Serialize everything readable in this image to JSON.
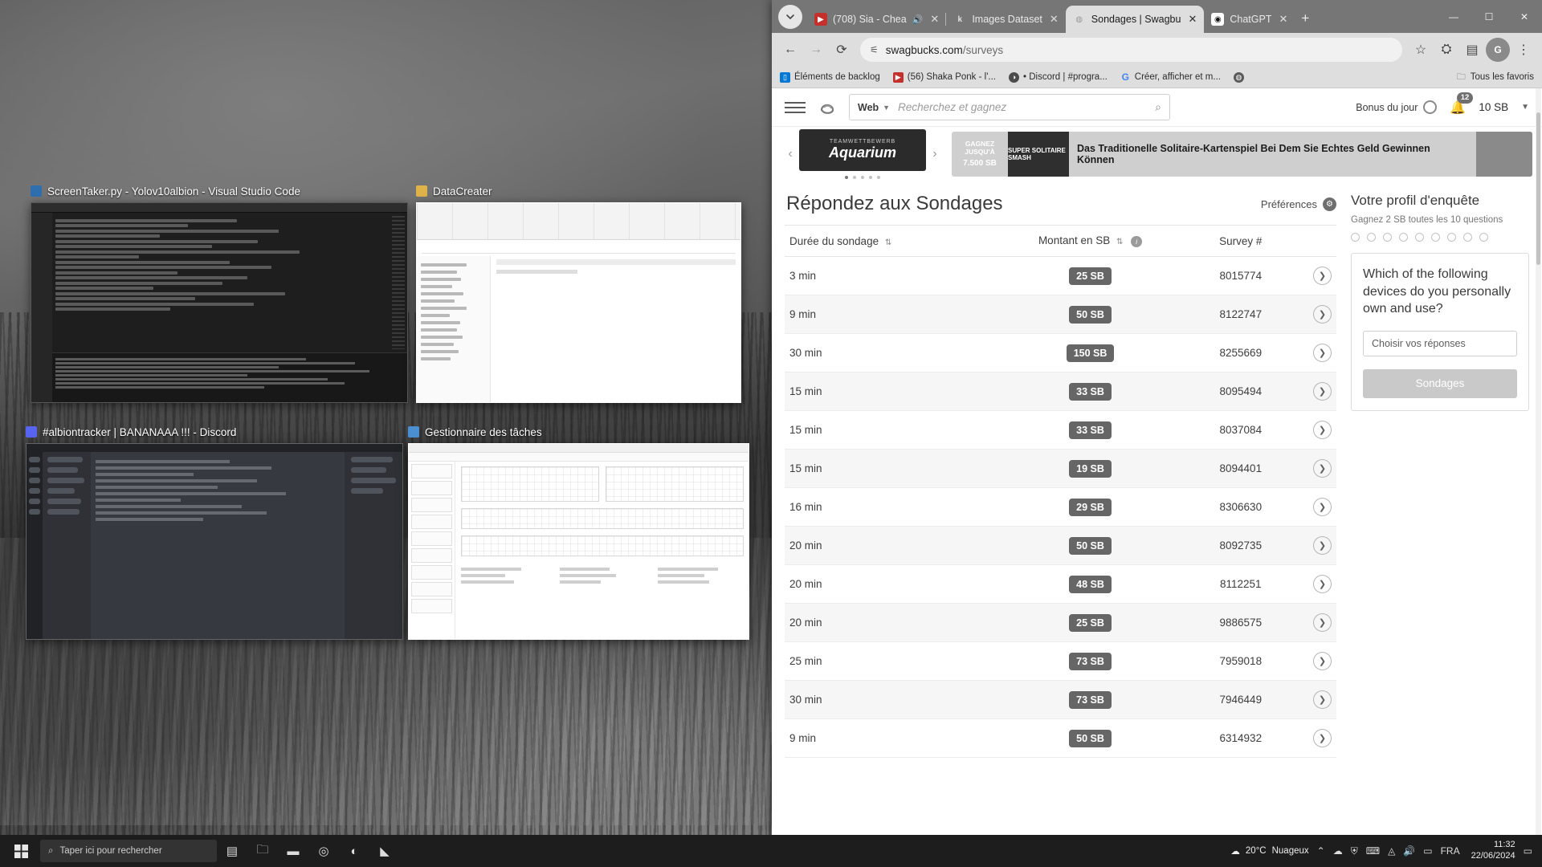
{
  "browser": {
    "tabs": [
      {
        "title": "(708) Sia - Chea",
        "favicon": "youtube-icon",
        "active": false,
        "muted_icon": "audio-icon"
      },
      {
        "title": "Images Dataset",
        "favicon": "kaggle-icon",
        "active": false
      },
      {
        "title": "Sondages | Swagbu",
        "favicon": "swagbucks-icon",
        "active": true
      },
      {
        "title": "ChatGPT",
        "favicon": "openai-icon",
        "active": false
      }
    ],
    "new_tab_label": "+",
    "url_host": "swagbucks.com",
    "url_path": "/surveys",
    "back_icon": "back-arrow-icon",
    "forward_icon": "forward-arrow-icon",
    "reload_icon": "reload-icon",
    "site_info_icon": "tune-icon",
    "bookmark_star_icon": "star-icon",
    "extensions_icon": "puzzle-icon",
    "split_icon": "reading-list-icon",
    "profile_initial": "G",
    "menu_icon": "kebab-menu-icon",
    "window_minimize": "—",
    "window_maximize": "☐",
    "window_close": "✕",
    "bookmarks": [
      {
        "label": "Éléments de backlog",
        "icon": "azure-devops-icon"
      },
      {
        "label": "(56) Shaka Ponk - l'...",
        "icon": "youtube-icon"
      },
      {
        "label": "• Discord | #progra...",
        "icon": "discord-icon"
      },
      {
        "label": "Créer, afficher et m...",
        "icon": "google-icon"
      },
      {
        "label": "",
        "icon": "globe-icon"
      }
    ],
    "all_bookmarks_label": "Tous les favoris",
    "all_bookmarks_icon": "folder-icon"
  },
  "swagbucks": {
    "menu_icon": "hamburger-menu-icon",
    "logo_icon": "swagbucks-logo-icon",
    "search": {
      "scope_label": "Web",
      "caret_icon": "chevron-down-icon",
      "placeholder": "Recherchez et gagnez",
      "search_icon": "search-icon"
    },
    "bonus_label": "Bonus du jour",
    "bonus_icon": "bonus-ring-icon",
    "notifications_icon": "bell-icon",
    "notifications_count": "12",
    "balance": "10 SB",
    "account_caret_icon": "chevron-down-icon",
    "promo_left": {
      "top_label": "TEAMWETTBEWERB",
      "main_label": "Aquarium",
      "prev_icon": "chevron-left-icon",
      "next_icon": "chevron-right-icon"
    },
    "promo_right": {
      "gagnez_label": "GAGNEZ JUSQU'À",
      "amount": "7.500 SB",
      "brand": "SUPER SOLITAIRE SMASH",
      "text": "Das Traditionelle Solitaire-Kartenspiel Bei Dem Sie Echtes Geld Gewinnen Können"
    },
    "surveys": {
      "heading": "Répondez aux Sondages",
      "prefs_label": "Préférences",
      "prefs_icon": "gear-icon",
      "columns": [
        {
          "label": "Durée du sondage",
          "sort_icon": "sort-icon"
        },
        {
          "label": "Montant en SB",
          "sort_icon": "sort-icon",
          "info_icon": "info-icon"
        },
        {
          "label": "Survey #"
        }
      ],
      "rows": [
        {
          "duration": "3 min",
          "amount": "25 SB",
          "survey_id": "8015774",
          "go_icon": "chevron-right-icon"
        },
        {
          "duration": "9 min",
          "amount": "50 SB",
          "survey_id": "8122747",
          "go_icon": "chevron-right-icon"
        },
        {
          "duration": "30 min",
          "amount": "150 SB",
          "survey_id": "8255669",
          "go_icon": "chevron-right-icon"
        },
        {
          "duration": "15 min",
          "amount": "33 SB",
          "survey_id": "8095494",
          "go_icon": "chevron-right-icon"
        },
        {
          "duration": "15 min",
          "amount": "33 SB",
          "survey_id": "8037084",
          "go_icon": "chevron-right-icon"
        },
        {
          "duration": "15 min",
          "amount": "19 SB",
          "survey_id": "8094401",
          "go_icon": "chevron-right-icon"
        },
        {
          "duration": "16 min",
          "amount": "29 SB",
          "survey_id": "8306630",
          "go_icon": "chevron-right-icon"
        },
        {
          "duration": "20 min",
          "amount": "50 SB",
          "survey_id": "8092735",
          "go_icon": "chevron-right-icon"
        },
        {
          "duration": "20 min",
          "amount": "48 SB",
          "survey_id": "8112251",
          "go_icon": "chevron-right-icon"
        },
        {
          "duration": "20 min",
          "amount": "25 SB",
          "survey_id": "9886575",
          "go_icon": "chevron-right-icon"
        },
        {
          "duration": "25 min",
          "amount": "73 SB",
          "survey_id": "7959018",
          "go_icon": "chevron-right-icon"
        },
        {
          "duration": "30 min",
          "amount": "73 SB",
          "survey_id": "7946449",
          "go_icon": "chevron-right-icon"
        },
        {
          "duration": "9 min",
          "amount": "50 SB",
          "survey_id": "6314932",
          "go_icon": "chevron-right-icon"
        }
      ]
    },
    "profile_panel": {
      "title": "Votre profil d'enquête",
      "subtitle": "Gagnez 2 SB toutes les 10 questions",
      "progress_dots": 9,
      "question": "Which of the following devices do you personally own and use?",
      "select_placeholder": "Choisir vos réponses",
      "submit_label": "Sondages"
    }
  },
  "desktop": {
    "windows": [
      {
        "title": "ScreenTaker.py - Yolov10albion - Visual Studio Code",
        "icon": "vscode-icon"
      },
      {
        "title": "DataCreater",
        "icon": "folder-icon"
      },
      {
        "title": "#albiontracker | BANANAAA !!! - Discord",
        "icon": "discord-icon"
      },
      {
        "title": "Gestionnaire des tâches",
        "icon": "taskmanager-icon"
      }
    ]
  },
  "taskbar": {
    "start_icon": "windows-start-icon",
    "search_icon": "search-icon",
    "search_placeholder": "Taper ici pour rechercher",
    "icons": [
      "task-view-icon",
      "file-explorer-icon",
      "folder-icon",
      "chrome-icon",
      "discord-icon",
      "vscode-icon"
    ],
    "tray": {
      "temperature": "20°C",
      "weather_text": "Nuageux",
      "weather_icon": "cloud-icon",
      "chevron_icon": "chevron-up-icon",
      "onedrive_icon": "onedrive-icon",
      "shield_icon": "shield-icon",
      "keyboard_icon": "keyboard-icon",
      "network_icon": "wifi-icon",
      "volume_icon": "volume-icon",
      "battery_icon": "battery-icon",
      "language": "FRA",
      "time": "11:32",
      "date": "22/06/2024",
      "notification_icon": "notification-icon"
    }
  }
}
